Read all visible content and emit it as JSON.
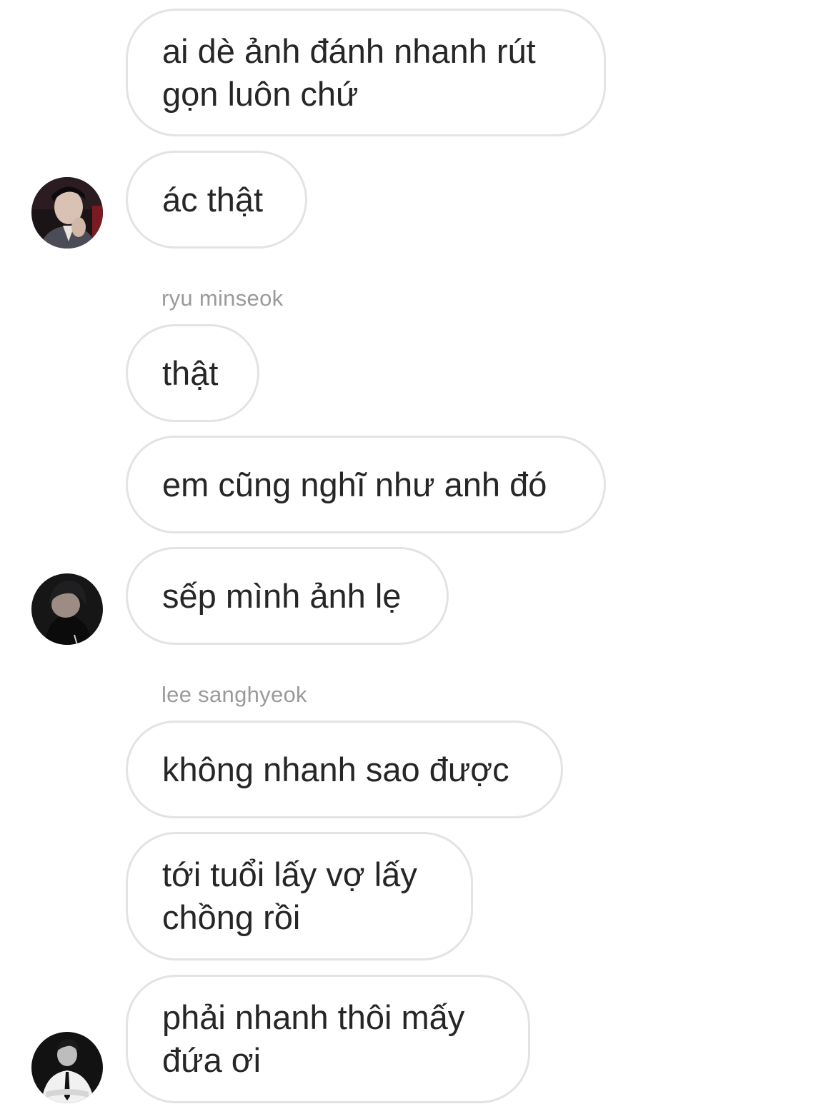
{
  "conversation": {
    "messages": [
      {
        "text": "ai dè ảnh đánh nhanh rút\ngọn luôn chứ"
      },
      {
        "text": "ác thật"
      },
      {
        "sender": "ryu minseok"
      },
      {
        "text": "thật"
      },
      {
        "text": "em cũng nghĩ như anh đó"
      },
      {
        "text": "sếp mình ảnh lẹ"
      },
      {
        "sender": "lee sanghyeok"
      },
      {
        "text": "không nhanh sao được"
      },
      {
        "text": "tới tuổi lấy vợ lấy\nchồng rồi"
      },
      {
        "text": "phải nhanh thôi mấy\nđứa ơi"
      }
    ]
  },
  "avatars": [
    {
      "icon": "profile-photo-icon"
    },
    {
      "icon": "profile-photo-icon"
    },
    {
      "icon": "profile-photo-icon"
    }
  ]
}
